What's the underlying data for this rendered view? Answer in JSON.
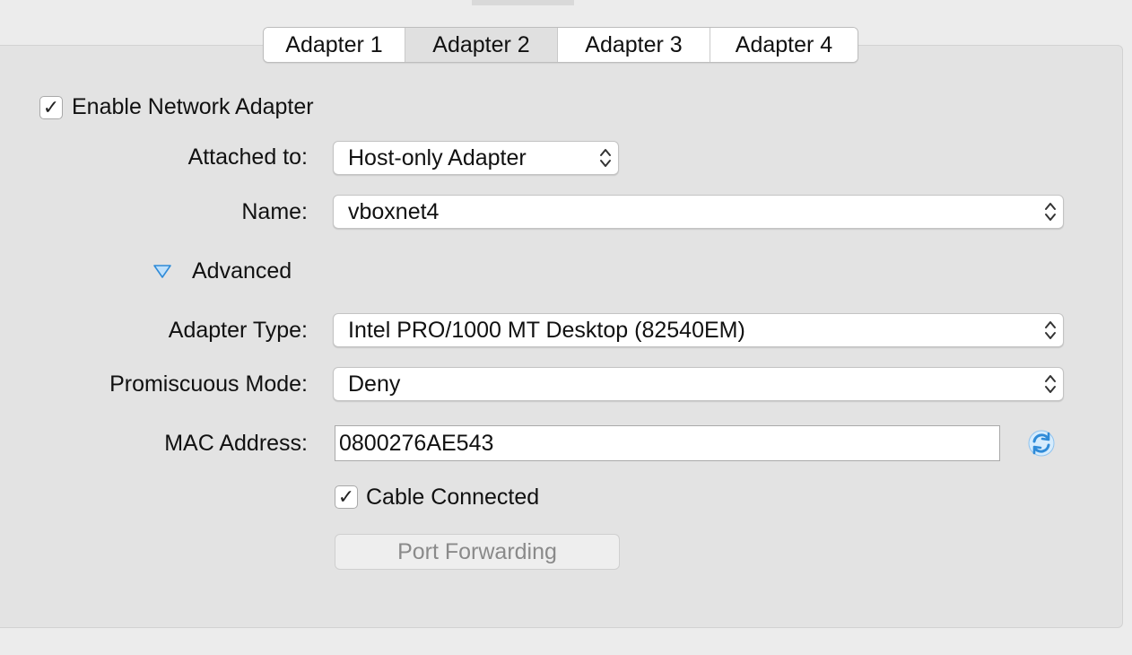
{
  "tabs": [
    {
      "label": "Adapter 1",
      "selected": false
    },
    {
      "label": "Adapter 2",
      "selected": true
    },
    {
      "label": "Adapter 3",
      "selected": false
    },
    {
      "label": "Adapter 4",
      "selected": false
    }
  ],
  "enable_adapter": {
    "label": "Enable Network Adapter",
    "checked": true,
    "check_glyph": "✓"
  },
  "attached_to": {
    "label": "Attached to:",
    "value": "Host-only Adapter"
  },
  "name": {
    "label": "Name:",
    "value": "vboxnet4"
  },
  "advanced": {
    "label": "Advanced",
    "expanded": true
  },
  "adapter_type": {
    "label": "Adapter Type:",
    "value": "Intel PRO/1000 MT Desktop (82540EM)"
  },
  "promiscuous_mode": {
    "label": "Promiscuous Mode:",
    "value": "Deny"
  },
  "mac_address": {
    "label": "MAC Address:",
    "value": "0800276AE543",
    "refresh_icon": "refresh-icon"
  },
  "cable_connected": {
    "label": "Cable Connected",
    "checked": true,
    "check_glyph": "✓"
  },
  "port_forwarding": {
    "label": "Port Forwarding",
    "enabled": false
  },
  "colors": {
    "accent": "#2f8bd8",
    "panel": "#e3e3e3",
    "window": "#ececec"
  }
}
